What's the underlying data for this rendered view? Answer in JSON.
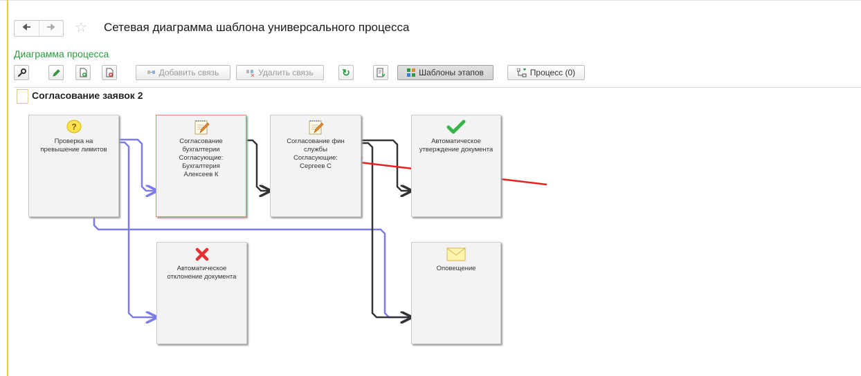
{
  "window": {
    "title": "Сетевая диаграмма шаблона универсального процесса"
  },
  "nav": {
    "back_icon": "arrow-left-icon",
    "forward_icon": "arrow-right-icon",
    "favorite_icon": "star-icon"
  },
  "section": {
    "title": "Диаграмма процесса"
  },
  "toolbar": {
    "add_link_label": "Добавить связь",
    "remove_link_label": "Удалить связь",
    "templates_label": "Шаблоны этапов",
    "process_label": "Процесс (0)"
  },
  "diagram": {
    "title": "Согласование заявок 2",
    "nodes": [
      {
        "id": "check",
        "icon": "question-icon",
        "text": [
          "Проверка на",
          "превышение лимитов"
        ]
      },
      {
        "id": "acc",
        "icon": "notepad-icon",
        "text": [
          "Согласование",
          "бухгалтерии",
          "Согласующие:",
          "Бухгалтерия",
          "Алексеев К"
        ]
      },
      {
        "id": "fin",
        "icon": "notepad-icon",
        "text": [
          "Согласование фин",
          "службы",
          "Согласующие:",
          "Сергеев С"
        ]
      },
      {
        "id": "approve",
        "icon": "checkmark-icon",
        "text": [
          "Автоматическое",
          "утверждение документа"
        ]
      },
      {
        "id": "reject",
        "icon": "cross-icon",
        "text": [
          "Автоматическое",
          "отклонение документа"
        ]
      },
      {
        "id": "notify",
        "icon": "envelope-icon",
        "text": [
          "Оповещение"
        ]
      }
    ]
  },
  "colors": {
    "accent_green": "#2a9d3f",
    "link_blue": "#7b7bea",
    "link_dark": "#333333",
    "annotation_red": "#e8201f"
  }
}
